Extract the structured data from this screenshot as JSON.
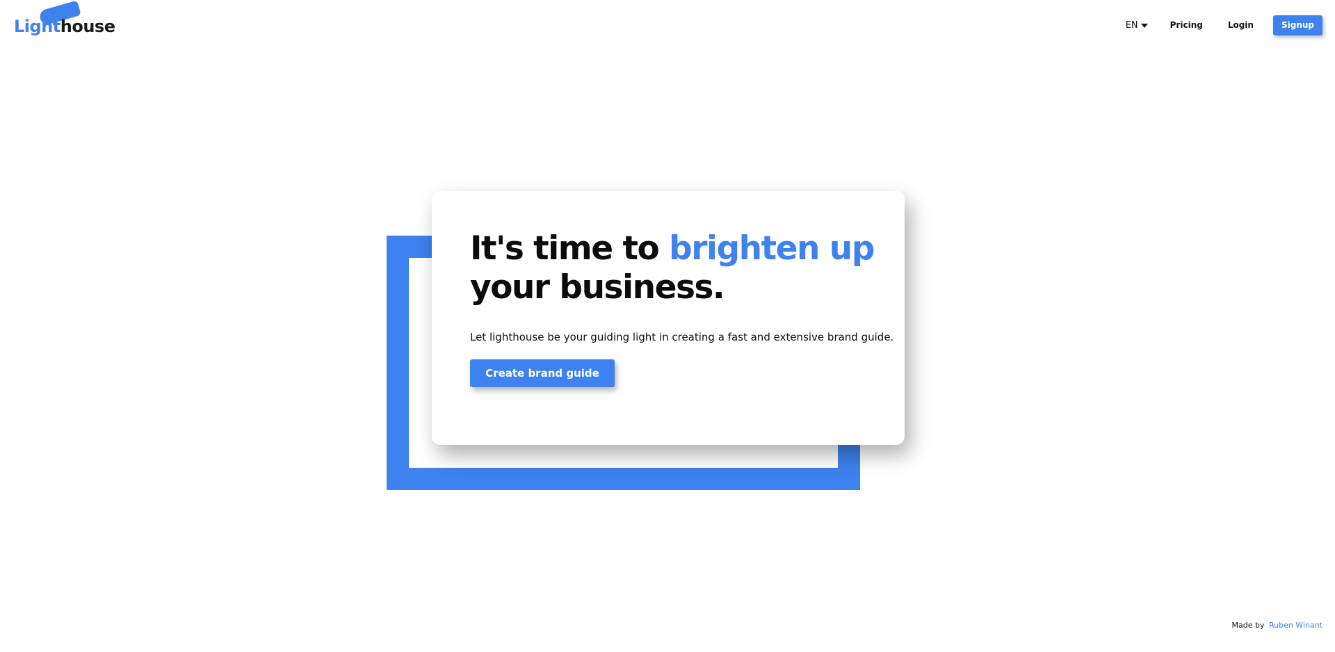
{
  "header": {
    "logo": {
      "part1": "Light",
      "part2": "house"
    },
    "language": {
      "selected": "EN"
    },
    "nav": {
      "pricing": "Pricing",
      "login": "Login",
      "signup": "Signup"
    }
  },
  "hero": {
    "headline_part1": "It's time to ",
    "headline_accent": "brighten up",
    "headline_line2": "your business.",
    "subtext": "Let lighthouse be your guiding light in creating a fast and extensive brand guide.",
    "cta_label": "Create brand guide"
  },
  "footer": {
    "prefix": "Made by",
    "author": "Ruben Winant"
  },
  "colors": {
    "accent": "#3d82ee",
    "text": "#0c0c0c",
    "background": "#ffffff"
  },
  "icons": {
    "language_dropdown": "caret-down-icon",
    "logo_mark": "lighthouse-beam-icon"
  }
}
